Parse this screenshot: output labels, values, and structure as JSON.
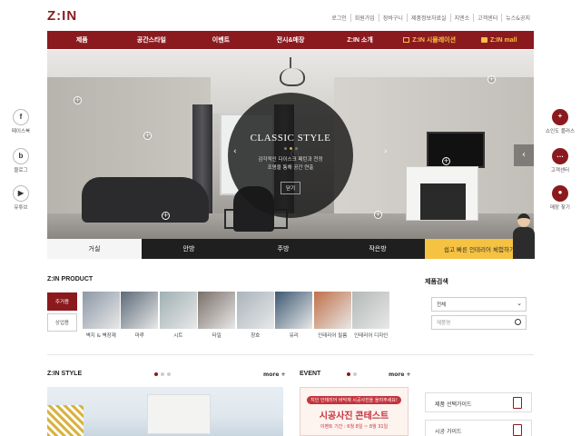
{
  "logo": "Z:IN",
  "utility": [
    "로그인",
    "회원가입",
    "장바구니",
    "제품정보자료실",
    "지엔소",
    "고객센터",
    "뉴스&공지"
  ],
  "nav": {
    "items": [
      "제품",
      "공간스타일",
      "이벤트",
      "전시&매장",
      "Z:IN 소개"
    ],
    "simulation": "Z:IN 시뮬레이션",
    "mall": "Z:IN mall"
  },
  "hero": {
    "title": "CLASSIC STYLE",
    "desc_line1": "감각적인 다이스크 패턴과 천정",
    "desc_line2": "조명을 통해 공간 연출",
    "button": "닫기",
    "tabs": [
      "거실",
      "안방",
      "주방",
      "작은방"
    ],
    "promo": "쉽고 빠른 인테리어 체험하기"
  },
  "side_left": [
    {
      "icon": "f",
      "label": "페이스북"
    },
    {
      "icon": "b",
      "label": "블로그"
    },
    {
      "icon": "▶",
      "label": "유튜브"
    }
  ],
  "side_right": [
    {
      "icon": "+",
      "label": "쇼인도 플러스"
    },
    {
      "icon": "…",
      "label": "고객센터"
    },
    {
      "icon": "●",
      "label": "매장 찾기"
    }
  ],
  "product": {
    "title": "Z:IN PRODUCT",
    "cats": [
      "주거용",
      "상업용"
    ],
    "items": [
      {
        "label": "벽지 & 벽장재",
        "color": "#8c98a6"
      },
      {
        "label": "마루",
        "color": "#5c6b78"
      },
      {
        "label": "시트",
        "color": "#9fb0b2"
      },
      {
        "label": "타일",
        "color": "#7a6f6a"
      },
      {
        "label": "창호",
        "color": "#a9b4bb"
      },
      {
        "label": "유리",
        "color": "#3d5a73"
      },
      {
        "label": "인테리어 필름",
        "color": "#c07048"
      },
      {
        "label": "인테리어 디자인",
        "color": "#b3b8b6"
      }
    ]
  },
  "search": {
    "title": "제품검색",
    "select_value": "전체",
    "input_placeholder": "제품명"
  },
  "style": {
    "title": "Z:IN STYLE",
    "more": "more +"
  },
  "event": {
    "title": "EVENT",
    "more": "more +",
    "small": "지인 인테리어 바닥재 시공사진을 올려주세요!",
    "big": "시공사진 콘테스트",
    "date": "이벤트 기간 : 6월 8일 ~ 8월 31일"
  },
  "guides": [
    "제품 선택가이드",
    "시공 가이드"
  ],
  "colors": {
    "brand": "#8b1a1f",
    "gold": "#f5c242"
  }
}
